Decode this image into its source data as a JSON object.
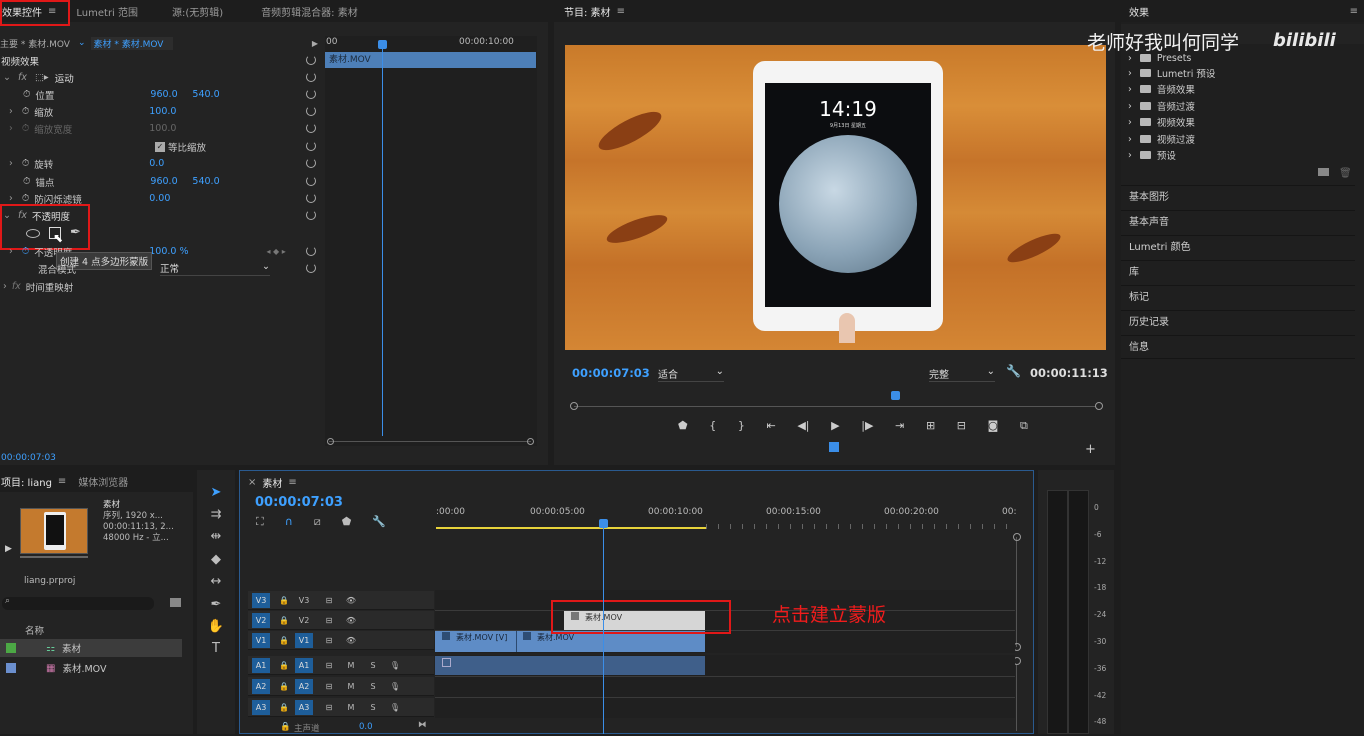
{
  "effect_controls": {
    "tabs": [
      "效果控件",
      "Lumetri 范围",
      "源:(无剪辑)",
      "音频剪辑混合器: 素材"
    ],
    "master_clip": "主要 * 素材.MOV",
    "sequence_clip": "素材 * 素材.MOV",
    "timecode_start": "00",
    "timecode_mid": "00:00:10:00",
    "clip_label": "素材.MOV",
    "section_label": "视频效果",
    "motion": "运动",
    "position_label": "位置",
    "position_x": "960.0",
    "position_y": "540.0",
    "scale_label": "缩放",
    "scale_value": "100.0",
    "scale_width_label": "缩放宽度",
    "scale_width_value": "100.0",
    "uniform_scale": "等比缩放",
    "rotation_label": "旋转",
    "rotation_value": "0.0",
    "anchor_label": "锚点",
    "anchor_x": "960.0",
    "anchor_y": "540.0",
    "anti_flicker_label": "防闪烁滤镜",
    "anti_flicker_value": "0.00",
    "opacity": "不透明度",
    "opacity_label": "不透明度",
    "opacity_value": "100.0 %",
    "blend_label": "混合模式",
    "blend_value": "正常",
    "time_remap": "时间重映射",
    "tooltip": "创建 4 点多边形蒙版",
    "current_time": "00:00:07:03"
  },
  "program": {
    "title": "节目: 素材",
    "timecode": "00:00:07:03",
    "fit": "适合",
    "quality": "完整",
    "duration": "00:00:11:13",
    "ipad_time": "14:19",
    "ipad_date": "9月13日 星期五"
  },
  "effects_panel": {
    "title": "效果",
    "watermark": "老师好我叫何同学",
    "brand": "bilibili",
    "items": [
      "Presets",
      "Lumetri 预设",
      "音频效果",
      "音频过渡",
      "视频效果",
      "视频过渡",
      "预设"
    ],
    "panels": [
      "基本图形",
      "基本声音",
      "Lumetri 颜色",
      "库",
      "标记",
      "历史记录",
      "信息"
    ]
  },
  "project": {
    "tabs": [
      "项目: liang",
      "媒体浏览器"
    ],
    "clip_name": "素材",
    "clip_info1": "序列, 1920 x...",
    "clip_info2": "00:00:11:13, 2...",
    "clip_info3": "48000 Hz - 立...",
    "project_file": "liang.prproj",
    "col_name": "名称",
    "items": [
      "素材",
      "素材.MOV"
    ]
  },
  "timeline": {
    "tab": "素材",
    "timecode": "00:00:07:03",
    "ruler": [
      ":00:00",
      "00:00:05:00",
      "00:00:10:00",
      "00:00:15:00",
      "00:00:20:00",
      "00:"
    ],
    "tracks": [
      "V3",
      "V2",
      "V1",
      "A1",
      "A2",
      "A3"
    ],
    "clip_v2": "素材.MOV",
    "clip_v1a": "素材.MOV [V]",
    "clip_v1b": "素材.MOV",
    "master": "主声道",
    "master_val": "0.0",
    "annotation": "点击建立蒙版"
  },
  "meter": {
    "scale": [
      "0",
      "-6",
      "-12",
      "-18",
      "-24",
      "-30",
      "-36",
      "-42",
      "-48"
    ]
  }
}
